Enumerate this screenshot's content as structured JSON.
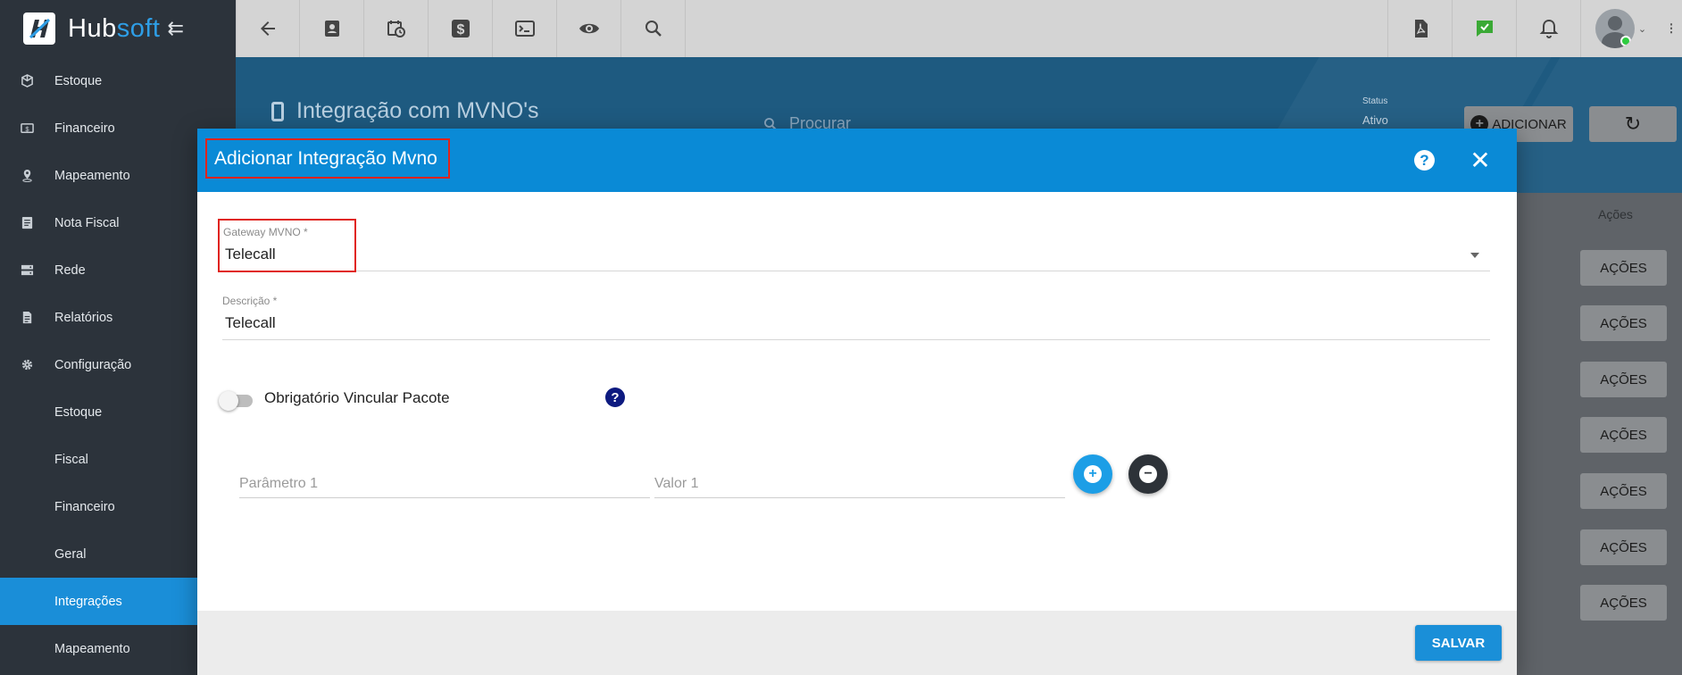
{
  "brand": {
    "name_a": "Hub",
    "name_b": "soft",
    "collapse_glyph": "⇇"
  },
  "topbar": {
    "left_icons": [
      "back-arrow-icon",
      "contact-card-icon",
      "calendar-clock-icon",
      "dollar-icon",
      "terminal-icon",
      "eye-icon",
      "search-icon"
    ],
    "right_icons": [
      "pdf-icon",
      "chat-check-icon",
      "bell-icon"
    ],
    "colors": {
      "chat_check": "#3aa935"
    }
  },
  "sidebar": {
    "items": [
      {
        "label": "Estoque",
        "icon": "box-icon"
      },
      {
        "label": "Financeiro",
        "icon": "money-icon"
      },
      {
        "label": "Mapeamento",
        "icon": "map-pin-icon"
      },
      {
        "label": "Nota Fiscal",
        "icon": "invoice-icon"
      },
      {
        "label": "Rede",
        "icon": "server-icon"
      },
      {
        "label": "Relatórios",
        "icon": "report-icon"
      },
      {
        "label": "Configuração",
        "icon": "gear-icon"
      }
    ],
    "sub_items": [
      "Estoque",
      "Fiscal",
      "Financeiro",
      "Geral",
      "Integrações",
      "Mapeamento"
    ],
    "active": "Integrações",
    "colors": {
      "bg": "#2c333b",
      "active": "#1a8ed8"
    }
  },
  "page": {
    "title": "Integração com MVNO's",
    "search_placeholder": "Procurar",
    "status_label": "Status",
    "status_value": "Ativo",
    "add_label": "ADICIONAR",
    "table": {
      "actions_header": "Ações",
      "row_action_label": "AÇÕES",
      "rows": 7
    }
  },
  "modal": {
    "title": "Adicionar Integração Mvno",
    "help_glyph": "?",
    "close_glyph": "✕",
    "gateway": {
      "label": "Gateway MVNO *",
      "value": "Telecall"
    },
    "descricao": {
      "label": "Descrição *",
      "value": "Telecall"
    },
    "toggle": {
      "label": "Obrigatório Vincular Pacote",
      "on": false,
      "help_glyph": "?"
    },
    "params": [
      {
        "parametro_placeholder": "Parâmetro 1",
        "valor_placeholder": "Valor 1"
      }
    ],
    "add_glyph": "+",
    "remove_glyph": "−",
    "save_label": "SALVAR",
    "colors": {
      "header": "#0a8ad6",
      "highlight": "#e0231b",
      "save": "#1a8fd8"
    }
  }
}
